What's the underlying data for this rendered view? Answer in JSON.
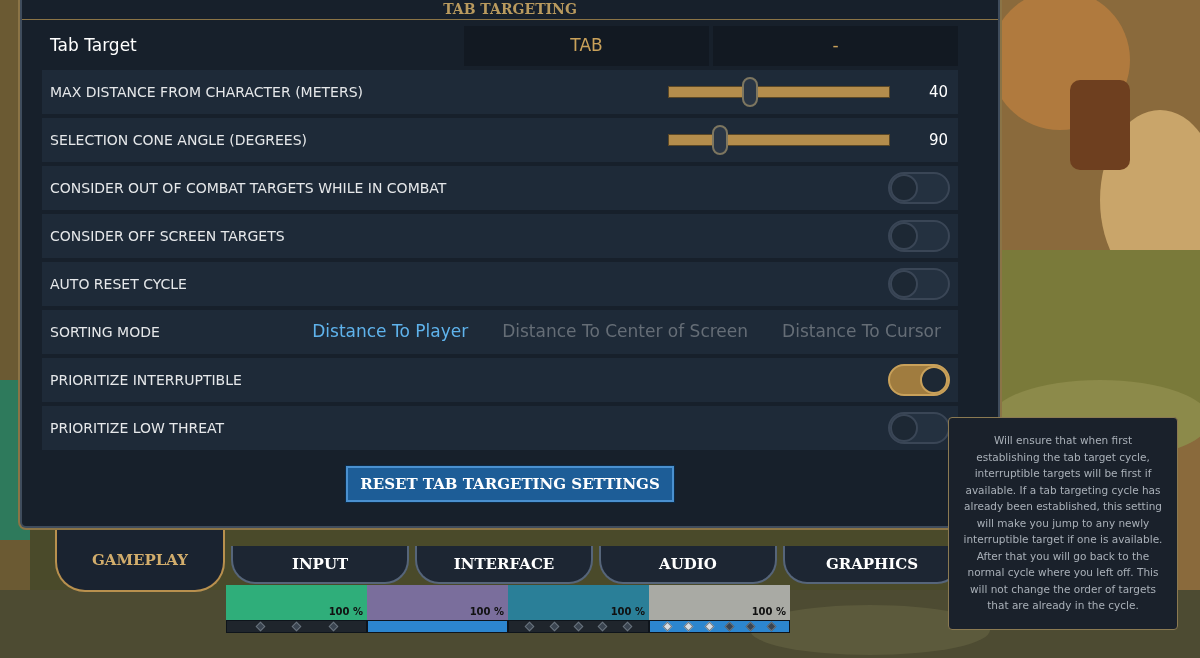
{
  "panel": {
    "title": "TAB TARGETING"
  },
  "settings": [
    {
      "kind": "keybind",
      "label": "Tab Target",
      "primary": "TAB",
      "secondary": "-"
    },
    {
      "kind": "slider",
      "label": "MAX DISTANCE FROM CHARACTER (METERS)",
      "level": 0.37,
      "reading": "40"
    },
    {
      "kind": "slider",
      "label": "SELECTION CONE ANGLE (DEGREES)",
      "level": 0.23,
      "reading": "90"
    },
    {
      "kind": "toggle",
      "label": "CONSIDER OUT OF COMBAT TARGETS WHILE IN COMBAT",
      "on": false
    },
    {
      "kind": "toggle",
      "label": "CONSIDER OFF SCREEN TARGETS",
      "on": false
    },
    {
      "kind": "toggle",
      "label": "AUTO RESET CYCLE",
      "on": false
    },
    {
      "kind": "choice",
      "label": "SORTING MODE",
      "options": [
        {
          "label": "Distance To Player",
          "selected": true
        },
        {
          "label": "Distance To Center of Screen",
          "selected": false
        },
        {
          "label": "Distance To Cursor",
          "selected": false
        }
      ]
    },
    {
      "kind": "toggle",
      "label": "PRIORITIZE INTERRUPTIBLE",
      "on": true
    },
    {
      "kind": "toggle",
      "label": "PRIORITIZE LOW THREAT",
      "on": false
    }
  ],
  "reset_button": "RESET TAB TARGETING SETTINGS",
  "tabs": [
    {
      "label": "GAMEPLAY",
      "selected": true
    },
    {
      "label": "INPUT",
      "selected": false
    },
    {
      "label": "INTERFACE",
      "selected": false
    },
    {
      "label": "AUDIO",
      "selected": false
    },
    {
      "label": "GRAPHICS",
      "selected": false
    }
  ],
  "meters": [
    {
      "reading": "100 %",
      "color": "#2fae7a",
      "active": false,
      "markers": [
        {
          "lit": false
        },
        {
          "lit": false
        },
        {
          "lit": false
        }
      ]
    },
    {
      "reading": "100 %",
      "color": "#7a6e9c",
      "active": true
    },
    {
      "reading": "100 %",
      "color": "#2a7f98",
      "active": false,
      "markers": [
        {
          "lit": false
        },
        {
          "lit": false
        },
        {
          "lit": false
        },
        {
          "lit": false
        },
        {
          "lit": false
        }
      ]
    },
    {
      "reading": "100 %",
      "color": "#a9aaa4",
      "active": true,
      "markers": [
        {
          "lit": true
        },
        {
          "lit": true
        },
        {
          "lit": true
        },
        {
          "lit": false
        },
        {
          "lit": false
        },
        {
          "lit": false
        }
      ]
    }
  ],
  "tooltip": "Will ensure that when first establishing the tab target cycle, interruptible targets will be first if available. If a tab targeting cycle has already been established, this setting will make you jump to any newly interruptible target if one is available. After that you will go back to the normal cycle where you left off. This will not change the order of targets that are already in the cycle."
}
